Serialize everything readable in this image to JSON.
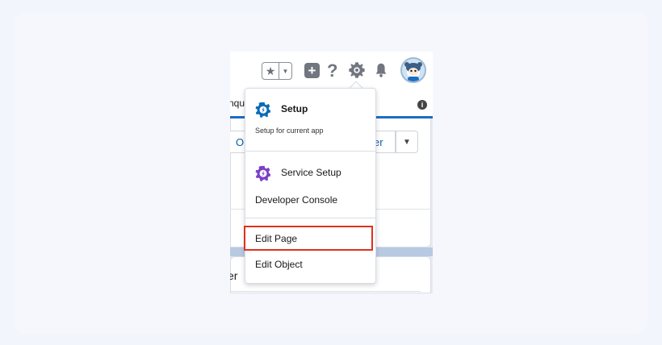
{
  "background_page": {
    "tab_fragment": "nqu",
    "info_badge": "i",
    "button_left_fragment": "O",
    "button_right_fragment": "er",
    "panel2_fragment": "er"
  },
  "header": {
    "favorites_icon": "star-icon",
    "favorites_menu_icon": "caret-down-icon",
    "global_actions_icon": "plus-icon",
    "help_icon": "question-icon",
    "help_symbol": "?",
    "setup_icon": "gear-icon",
    "notifications_icon": "bell-icon",
    "avatar": "astro-avatar"
  },
  "setup_menu": {
    "setup": {
      "label": "Setup",
      "description": "Setup for current app",
      "icon": "setup-gear-icon"
    },
    "service_setup": {
      "label": "Service Setup",
      "icon": "service-gear-icon"
    },
    "developer_console": {
      "label": "Developer Console"
    },
    "edit_page": {
      "label": "Edit Page",
      "highlighted": true
    },
    "edit_object": {
      "label": "Edit Object"
    }
  },
  "colors": {
    "highlight": "#e2301a",
    "setup_icon": "#0b6bb5",
    "service_icon": "#7b3fc7",
    "brand_blue": "#1b6ec2"
  }
}
